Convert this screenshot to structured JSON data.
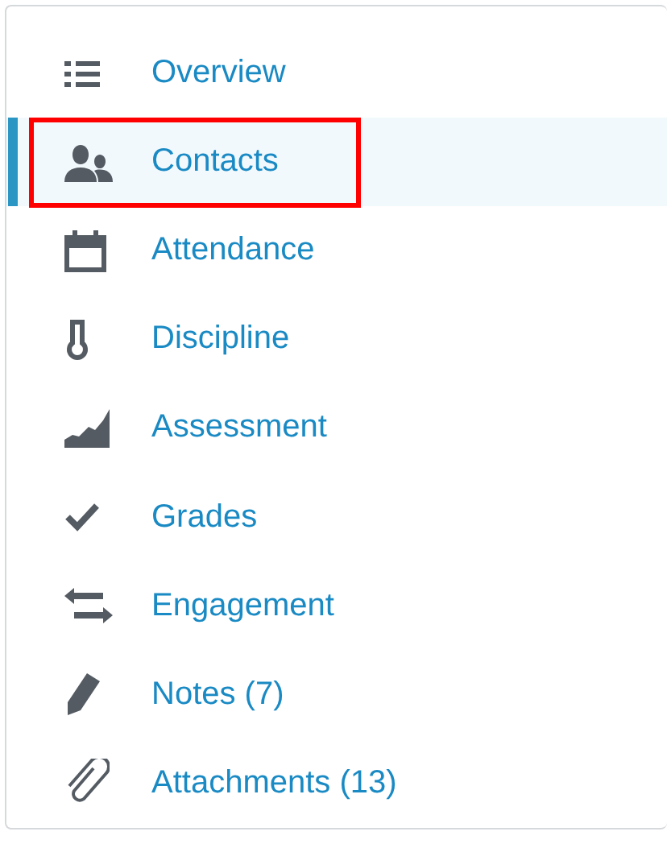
{
  "nav": {
    "items": [
      {
        "label": "Overview",
        "selected": false,
        "highlighted": false
      },
      {
        "label": "Contacts",
        "selected": true,
        "highlighted": true
      },
      {
        "label": "Attendance",
        "selected": false,
        "highlighted": false
      },
      {
        "label": "Discipline",
        "selected": false,
        "highlighted": false
      },
      {
        "label": "Assessment",
        "selected": false,
        "highlighted": false
      },
      {
        "label": "Grades",
        "selected": false,
        "highlighted": false
      },
      {
        "label": "Engagement",
        "selected": false,
        "highlighted": false
      },
      {
        "label": "Notes (7)",
        "selected": false,
        "highlighted": false
      },
      {
        "label": "Attachments (13)",
        "selected": false,
        "highlighted": false
      }
    ]
  }
}
